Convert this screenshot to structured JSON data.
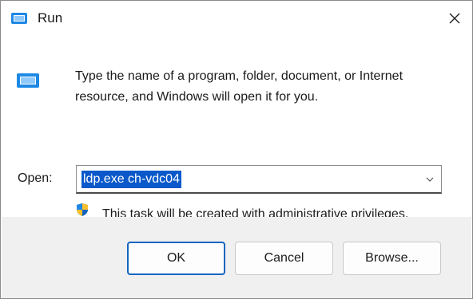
{
  "window": {
    "title": "Run",
    "close_icon": "close-icon",
    "app_icon": "run-app-icon"
  },
  "main": {
    "description": "Type the name of a program, folder, document, or Internet resource, and Windows will open it for you.",
    "open_label": "Open:",
    "open_value": "ldp.exe ch-vdc04",
    "admin_note": "This task will be created with administrative privileges.",
    "shield_icon": "uac-shield-icon",
    "dropdown_icon": "chevron-down-icon"
  },
  "buttons": {
    "ok": "OK",
    "cancel": "Cancel",
    "browse": "Browse..."
  },
  "colors": {
    "selection": "#0a58ca",
    "primary_border": "#1565c0",
    "footer_bg": "#f0f0f0"
  }
}
